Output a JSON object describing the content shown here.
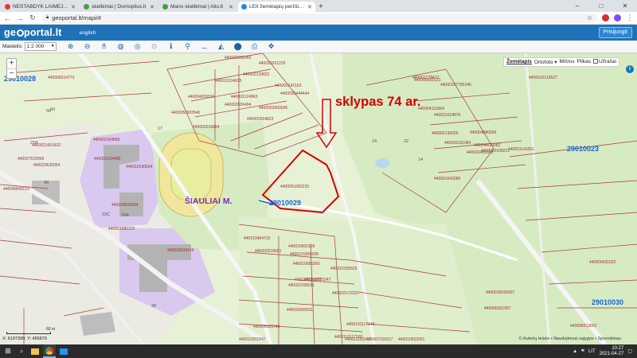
{
  "browser": {
    "tabs": [
      {
        "label": "NESTABDYK LAIMĖJIMŲ! Ža",
        "favicon_color": "#e53935",
        "active": false
      },
      {
        "label": "skelbimai | Domoplius.lt",
        "favicon_color": "#43a047",
        "active": false
      },
      {
        "label": "Mano skelbimai | Alio.lt",
        "favicon_color": "#43a047",
        "active": false
      },
      {
        "label": "LEII žemėlapių peržiūros progra",
        "favicon_color": "#1e88e5",
        "active": true
      }
    ],
    "new_tab": "+",
    "url": "geoportal.lt/mapi/#",
    "window_controls": [
      "–",
      "□",
      "✕"
    ]
  },
  "header": {
    "logo_before": "ge",
    "logo_after": "portal.lt",
    "language": "english",
    "login": "Prisijungti"
  },
  "toolbar": {
    "scale_label": "Mastelis",
    "scale_value": "1:2 000",
    "tools": [
      "zoom-in-icon",
      "zoom-out-icon",
      "pan-icon",
      "globe-icon",
      "target-icon",
      "extent-icon",
      "info-icon",
      "link-icon",
      "measure-icon",
      "profile-icon",
      "export-icon",
      "print-icon",
      "settings-icon"
    ]
  },
  "map": {
    "zoom_in": "+",
    "zoom_out": "−",
    "layers": [
      "Žemėlapis",
      "Ortofoto ▾",
      "Mišrus",
      "Pilkas",
      "Užrašai"
    ],
    "selected_layer": "Žemėlapis",
    "info_button": "i",
    "annotation": "sklypas 74 ar.",
    "city_label": "ŠIAULIAI M.",
    "block_ids": [
      "29010028",
      "29010029",
      "29010023",
      "29010030"
    ],
    "parcel_ids": [
      "440002050342",
      "440010201229",
      "440002129822",
      "440010134615",
      "440002142163",
      "4400020444444",
      "440002124963",
      "440004055534",
      "440002556494",
      "4400023050546",
      "4400050503540",
      "440002564822",
      "440002515894",
      "440008314773",
      "4400021601822",
      "440027519995",
      "440040042010",
      "440020620004",
      "440002154495",
      "440002104895",
      "4400051082225",
      "440010190634",
      "440020509004",
      "440051082220",
      "440020509419",
      "440010404710",
      "440002518001",
      "440010501006",
      "440010085260",
      "440010136470",
      "440001642086",
      "440001141001",
      "4400010108221",
      "4400018025007",
      "440006301007",
      "440008313602",
      "440002130025",
      "440003161084",
      "440002451602",
      "44000107755246",
      "440001778472",
      "440006651521",
      "4400016113527",
      "440021024876",
      "440004110064",
      "440004880006",
      "440004610082",
      "440000431022",
      "440020000011",
      "4400131556005",
      "440010105525",
      "440012525247",
      "440010106011",
      "440010172231",
      "4400101117140",
      "4400110117160",
      "440005123740",
      "440011001547",
      "440011101547",
      "440007102017",
      "440010552001"
    ],
    "road_numbers": [
      "29A",
      "23C",
      "24",
      "22",
      "14",
      "17",
      "56",
      "38",
      "40",
      "60",
      "21B"
    ],
    "coordinates": "X: 6197390, Y: 455879",
    "scale_bar": "60 m",
    "copyright": "© Autorių teisės • Naudojimosi sąlygos • Sprendimas"
  },
  "taskbar": {
    "start": "⊞",
    "search": "⌕",
    "apps": [
      "file-explorer-icon",
      "chrome-icon",
      "photos-icon"
    ],
    "tray": {
      "lang": "LIT",
      "time": "10:27",
      "date": "2021-04-27"
    }
  },
  "colors": {
    "header_blue": "#1f72b7",
    "parcel_red": "#9c2f2f",
    "annotation_red": "#d40000",
    "block_blue": "#1a62c7",
    "map_green": "#d7ebc3",
    "purple_zone": "#d7c9ee",
    "stadium": "#efe79b"
  }
}
